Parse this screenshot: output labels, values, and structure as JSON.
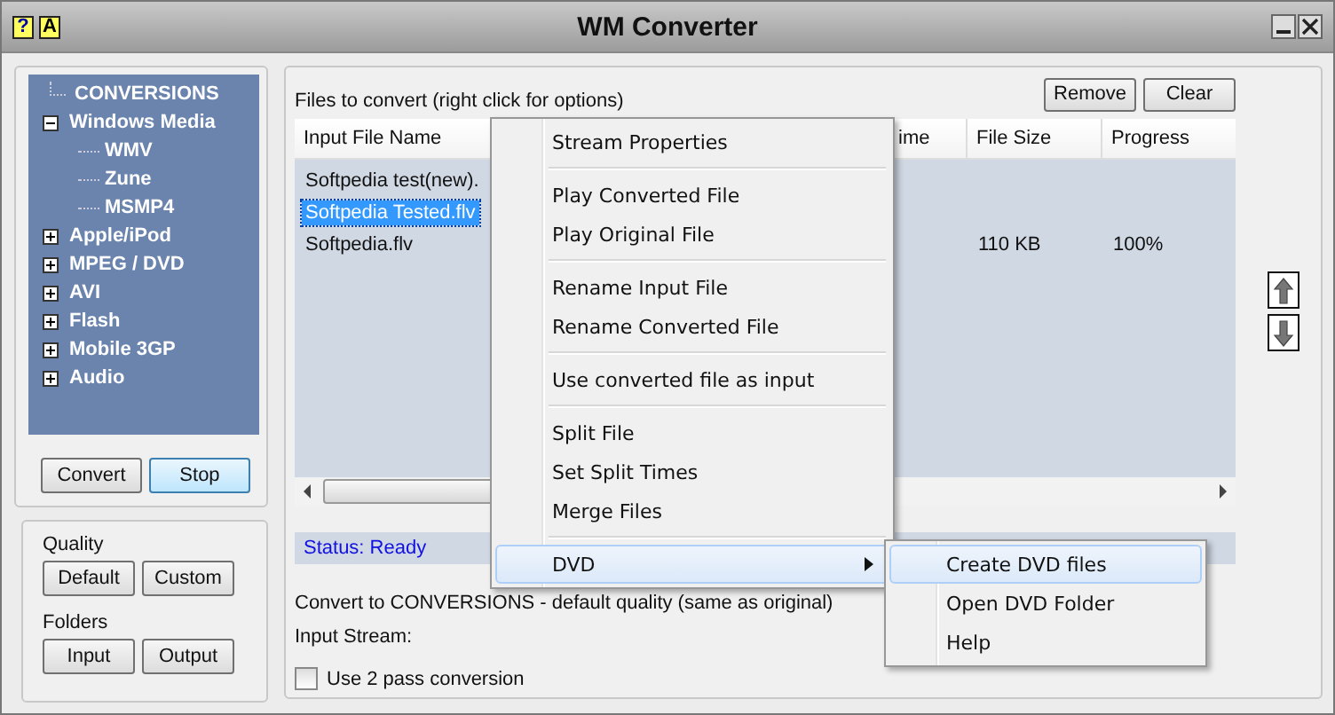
{
  "window": {
    "title": "WM Converter",
    "title_buttons": [
      "?",
      "A"
    ]
  },
  "tree": [
    {
      "label": "CONVERSIONS",
      "expanded": true,
      "children": [
        {
          "label": "Windows Media",
          "expanded": true,
          "children": [
            {
              "label": "WMV"
            },
            {
              "label": "Zune"
            },
            {
              "label": "MSMP4"
            }
          ]
        },
        {
          "label": "Apple/iPod",
          "expanded": false
        },
        {
          "label": "MPEG / DVD",
          "expanded": false
        },
        {
          "label": "AVI",
          "expanded": false
        },
        {
          "label": "Flash",
          "expanded": false
        },
        {
          "label": "Mobile 3GP",
          "expanded": false
        },
        {
          "label": "Audio",
          "expanded": false
        }
      ]
    }
  ],
  "convert_buttons": [
    {
      "label": "Convert",
      "focused": false
    },
    {
      "label": "Stop",
      "focused": true
    }
  ],
  "quality": {
    "label": "Quality",
    "buttons": [
      "Default",
      "Custom"
    ]
  },
  "folders": {
    "label": "Folders",
    "buttons": [
      "Input",
      "Output"
    ]
  },
  "files": {
    "label": "Files to convert (right click for options)",
    "buttons": [
      "Remove",
      "Clear"
    ],
    "columns": [
      "Input File Name",
      "ime",
      "File Size",
      "Progress"
    ],
    "rows": [
      {
        "cells": [
          "Softpedia test(new).",
          "",
          "",
          ""
        ],
        "selected": false
      },
      {
        "cells": [
          "Softpedia Tested.flv",
          "",
          "",
          ""
        ],
        "selected": true
      },
      {
        "cells": [
          "Softpedia.flv",
          "",
          "110 KB",
          "100%"
        ],
        "selected": false
      }
    ]
  },
  "status": "Status: Ready",
  "convert_to": "Convert to CONVERSIONS - default quality (same as original)",
  "input_stream": "Input Stream:",
  "two_pass": {
    "label": "Use 2 pass conversion",
    "checked": false
  },
  "context_menu": {
    "groups": [
      [
        {
          "label": "Stream Properties",
          "highlighted": false,
          "has_submenu": false
        }
      ],
      [
        {
          "label": "Play Converted File",
          "highlighted": false,
          "has_submenu": false
        },
        {
          "label": "Play Original File",
          "highlighted": false,
          "has_submenu": false
        }
      ],
      [
        {
          "label": "Rename Input File",
          "highlighted": false,
          "has_submenu": false
        },
        {
          "label": "Rename Converted File",
          "highlighted": false,
          "has_submenu": false
        }
      ],
      [
        {
          "label": "Use converted file as input",
          "highlighted": false,
          "has_submenu": false
        }
      ],
      [
        {
          "label": "Split File",
          "highlighted": false,
          "has_submenu": false
        },
        {
          "label": "Set Split Times",
          "highlighted": false,
          "has_submenu": false
        },
        {
          "label": "Merge Files",
          "highlighted": false,
          "has_submenu": false
        }
      ],
      [
        {
          "label": "DVD",
          "highlighted": true,
          "has_submenu": true
        }
      ]
    ]
  },
  "submenu": [
    {
      "label": "Create DVD files",
      "highlighted": true
    },
    {
      "label": "Open DVD Folder",
      "highlighted": false
    },
    {
      "label": "Help",
      "highlighted": false
    }
  ]
}
